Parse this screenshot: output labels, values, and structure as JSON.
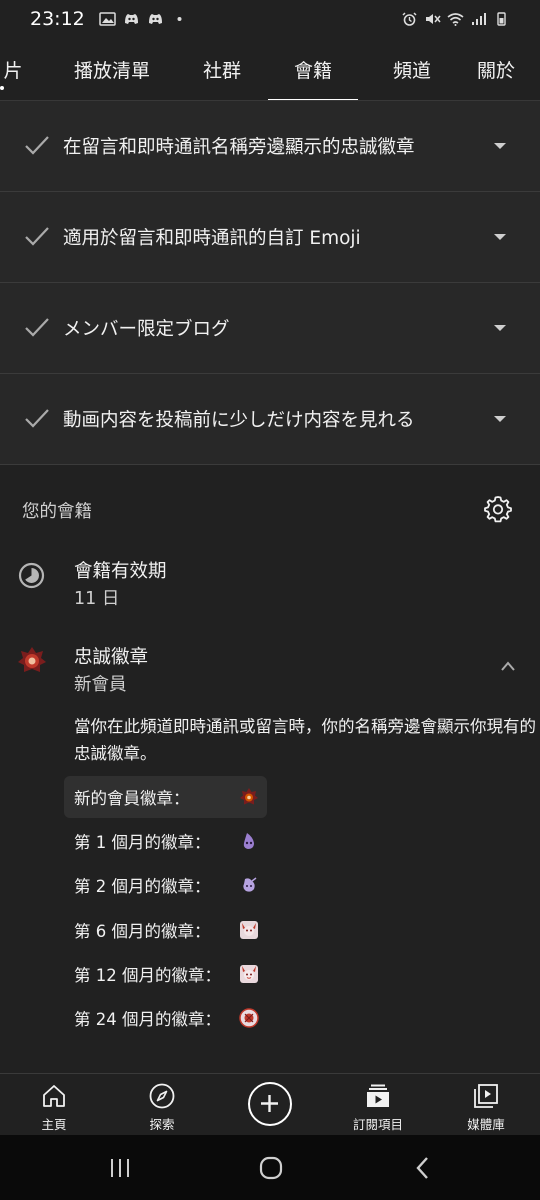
{
  "status_bar": {
    "time": "23:12"
  },
  "tabs": [
    {
      "label": "片"
    },
    {
      "label": "播放清單"
    },
    {
      "label": "社群"
    },
    {
      "label": "會籍"
    },
    {
      "label": "頻道"
    },
    {
      "label": "關於"
    }
  ],
  "active_tab": "會籍",
  "perks": [
    {
      "label": "在留言和即時通訊名稱旁邊顯示的忠誠徽章"
    },
    {
      "label": "適用於留言和即時通訊的自訂 Emoji"
    },
    {
      "label": "メンバー限定ブログ"
    },
    {
      "label": "動画内容を投稿前に少しだけ内容を見れる"
    }
  ],
  "membership": {
    "section_title": "您的會籍",
    "validity_title": "會籍有效期",
    "validity_value": "11 日",
    "loyalty_title": "忠誠徽章",
    "loyalty_value": "新會員",
    "description": "當你在此頻道即時通訊或留言時，你的名稱旁邊會顯示你現有的忠誠徽章。",
    "badges": [
      {
        "label": "新的會員徽章：",
        "icon": "new-member-badge-icon",
        "highlighted": true
      },
      {
        "label": "第 1 個月的徽章：",
        "icon": "month-1-badge-icon",
        "highlighted": false
      },
      {
        "label": "第 2 個月的徽章：",
        "icon": "month-2-badge-icon",
        "highlighted": false
      },
      {
        "label": "第 6 個月的徽章：",
        "icon": "month-6-badge-icon",
        "highlighted": false
      },
      {
        "label": "第 12 個月的徽章：",
        "icon": "month-12-badge-icon",
        "highlighted": false
      },
      {
        "label": "第 24 個月的徽章：",
        "icon": "month-24-badge-icon",
        "highlighted": false
      }
    ]
  },
  "bottom_nav": [
    {
      "label": "主頁",
      "icon": "home-icon"
    },
    {
      "label": "探索",
      "icon": "compass-icon"
    },
    {
      "label": "",
      "icon": "create-plus-icon"
    },
    {
      "label": "訂閱項目",
      "icon": "subscriptions-icon"
    },
    {
      "label": "媒體庫",
      "icon": "library-icon"
    }
  ],
  "colors": {
    "background": "#212121",
    "perk_background": "#282828",
    "text": "#f1f1f1",
    "secondary_text": "#cfcfcf"
  }
}
